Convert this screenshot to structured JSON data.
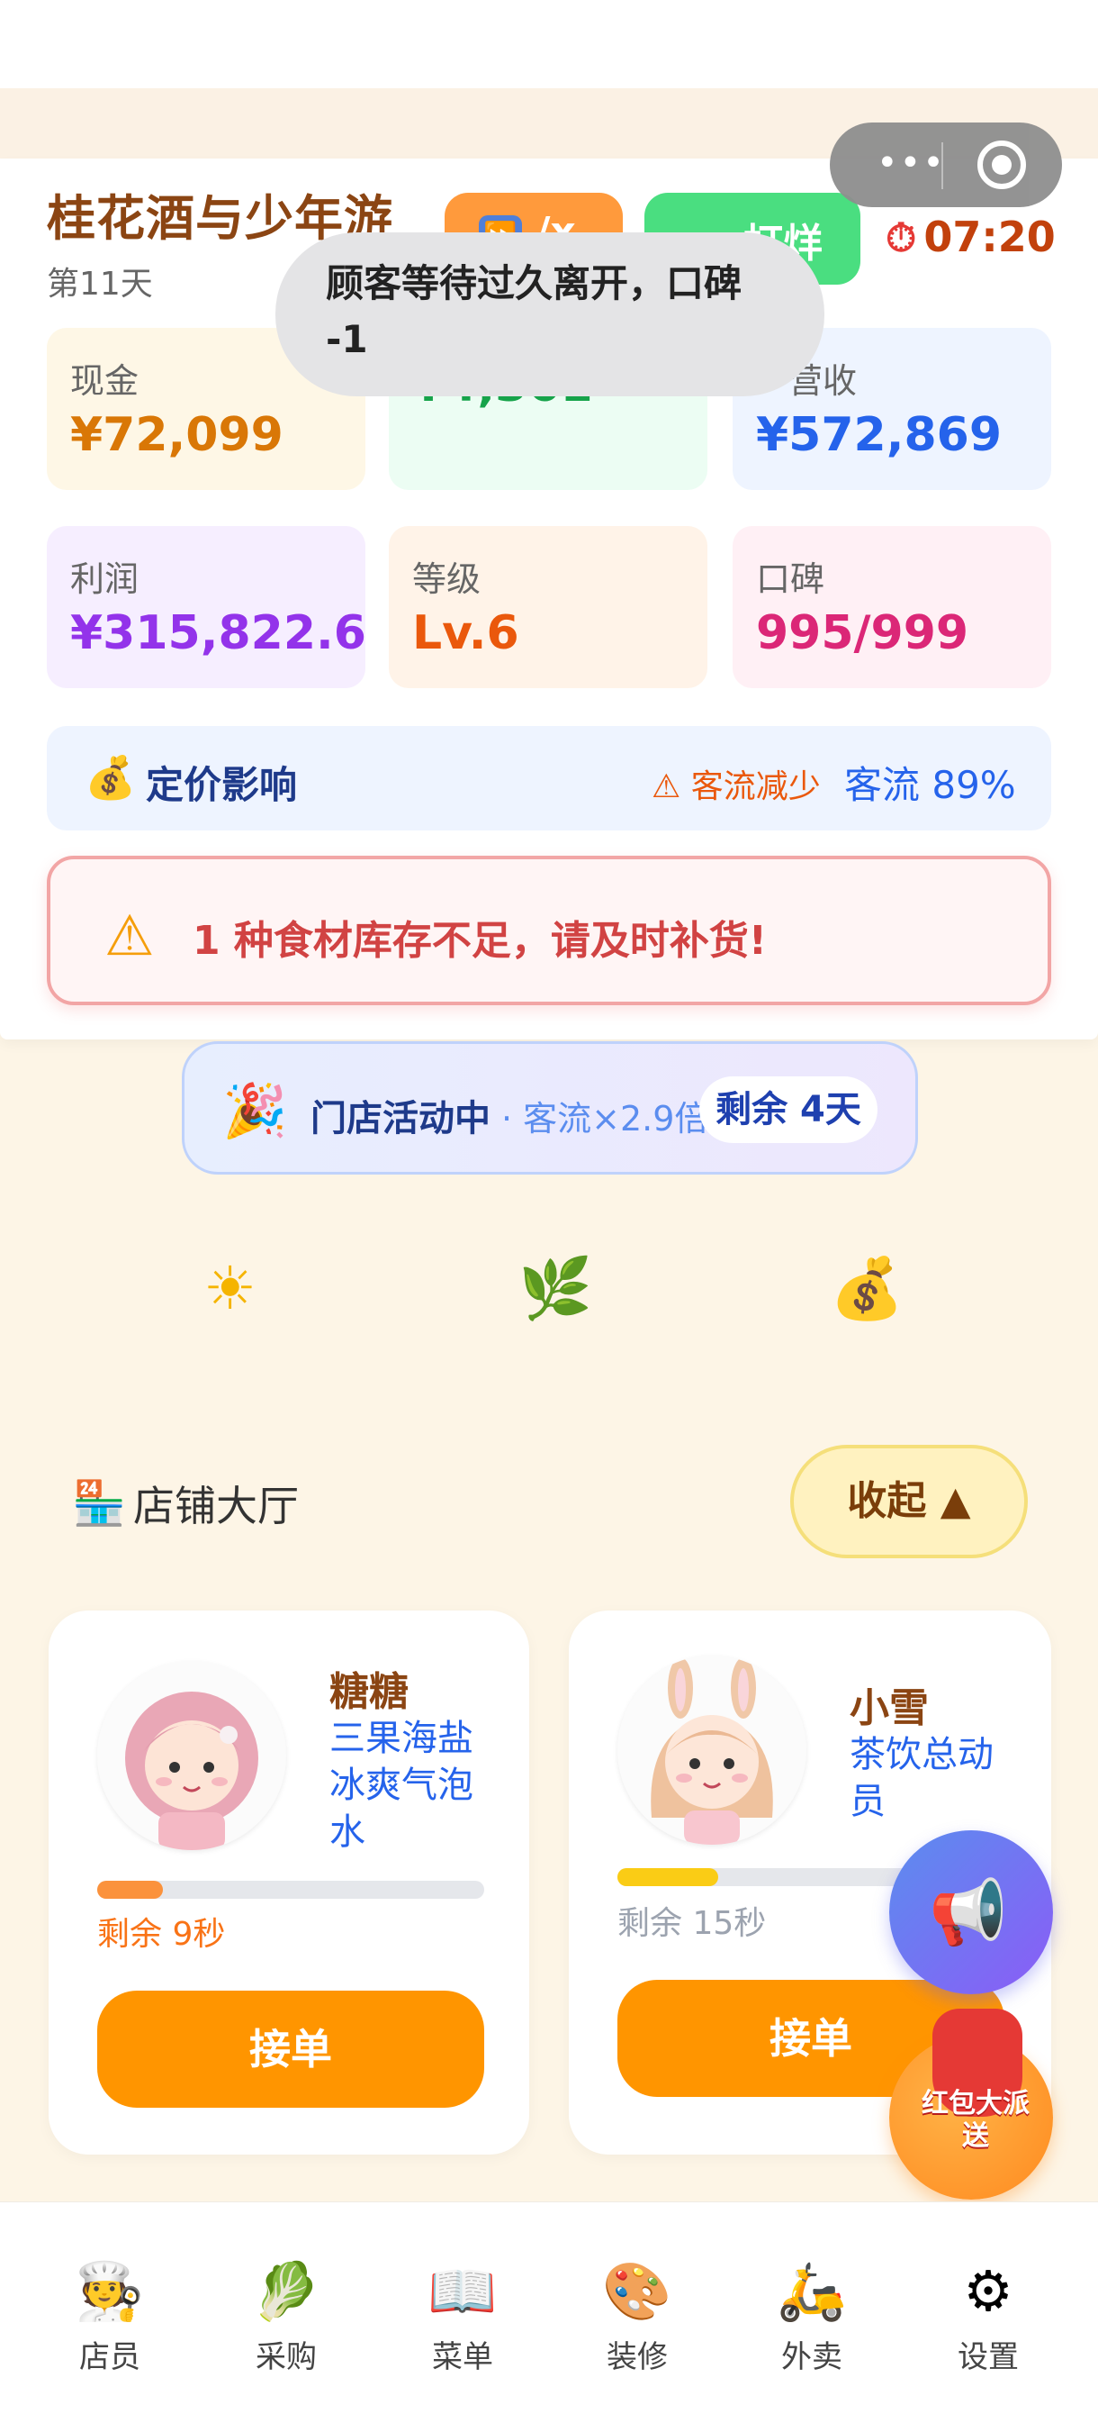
{
  "header": {
    "title": "桂花酒与少年游",
    "day": "第11天",
    "speed_label": "/x",
    "speed_icon": "fast-forward-icon",
    "close_shop_label": "打烊",
    "time": "07:20"
  },
  "toast": {
    "message": "顾客等待过久离开，口碑 -1"
  },
  "stats": [
    {
      "label": "现金",
      "value": "¥72,099",
      "color": "#D97706",
      "bg": "#FEF7E6"
    },
    {
      "label": "",
      "value": "¥4,361",
      "color": "#16A34A",
      "bg": "#ECFDF3"
    },
    {
      "label": "营收",
      "value": "¥572,869",
      "color": "#2563EB",
      "bg": "#EEF4FF"
    },
    {
      "label": "利润",
      "value": "¥315,822.6",
      "color": "#9333EA",
      "bg": "#F6EEFF"
    },
    {
      "label": "等级",
      "value": "Lv.6",
      "color": "#EA580C",
      "bg": "#FFF3E8"
    },
    {
      "label": "口碑",
      "value": "995/999",
      "color": "#DB2777",
      "bg": "#FFF0F5"
    }
  ],
  "pricing": {
    "title": "定价影响",
    "warning": "⚠ 客流减少",
    "flow": "客流 89%"
  },
  "alert": {
    "text": "1 种食材库存不足，请及时补货!"
  },
  "event": {
    "title": "门店活动中",
    "detail": "· 客流×2.9倍",
    "remaining": "剩余 4天"
  },
  "weather_icons": [
    "sun-icon",
    "leaf-icon",
    "money-bag-icon"
  ],
  "hall": {
    "title": "店铺大厅",
    "collapse_label": "收起 ▲"
  },
  "customers": [
    {
      "name": "糖糖",
      "drink": "三果海盐冰爽气泡水",
      "remaining": "剩余 9秒",
      "progress": 0.17,
      "progress_color": "#FB923C",
      "remaining_color": "#F97316",
      "accept_label": "接单"
    },
    {
      "name": "小雪",
      "drink": "茶饮总动员",
      "remaining": "剩余 15秒",
      "progress": 0.26,
      "progress_color": "#FACC15",
      "remaining_color": "#9CA3AF",
      "accept_label": "接单"
    }
  ],
  "fab": {
    "red_packet_label": "红包大派送"
  },
  "nav": [
    {
      "label": "店员",
      "icon": "chef-icon"
    },
    {
      "label": "采购",
      "icon": "lettuce-icon"
    },
    {
      "label": "菜单",
      "icon": "book-icon"
    },
    {
      "label": "装修",
      "icon": "palette-icon"
    },
    {
      "label": "外卖",
      "icon": "scooter-icon"
    },
    {
      "label": "设置",
      "icon": "gear-icon"
    }
  ]
}
